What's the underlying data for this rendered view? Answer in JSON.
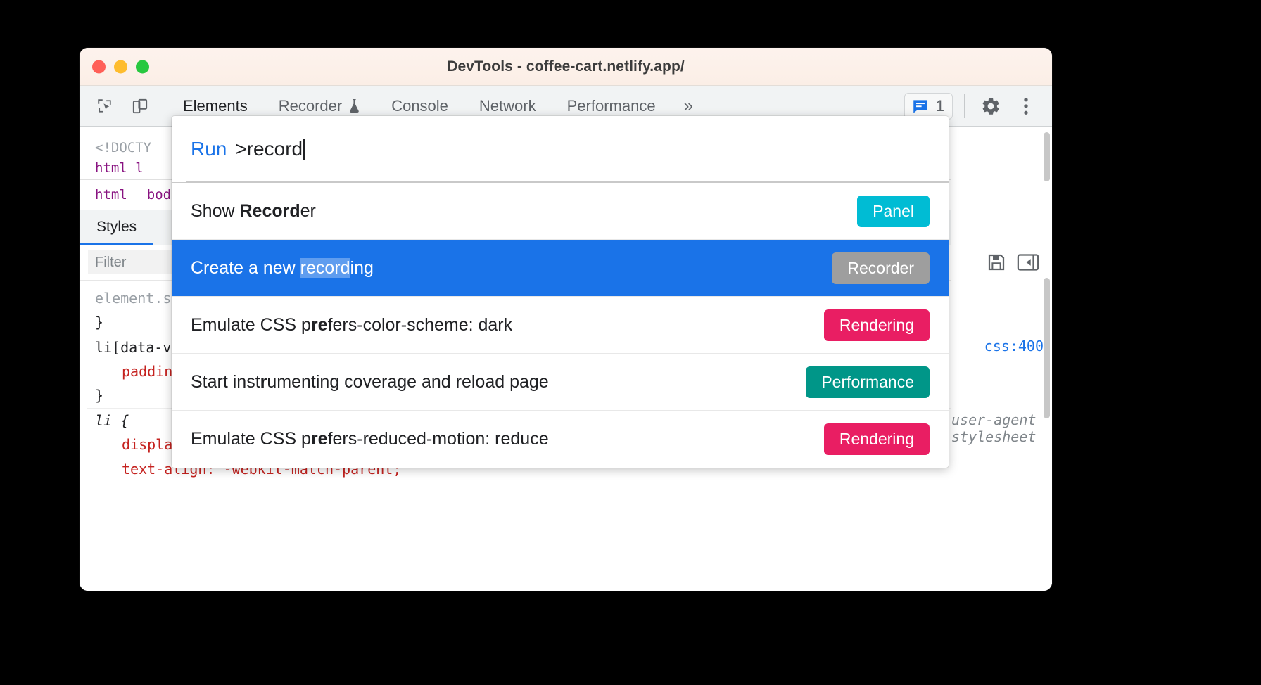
{
  "window": {
    "title": "DevTools - coffee-cart.netlify.app/",
    "traffic_lights": [
      "close-red",
      "minimize-yellow",
      "maximize-green"
    ]
  },
  "toolbar": {
    "icons": [
      "inspect-element-icon",
      "device-toolbar-icon"
    ],
    "tabs": [
      {
        "label": "Elements",
        "active": true,
        "icon": ""
      },
      {
        "label": "Recorder",
        "active": false,
        "icon": "flask-icon"
      },
      {
        "label": "Console",
        "active": false,
        "icon": ""
      },
      {
        "label": "Network",
        "active": false,
        "icon": ""
      },
      {
        "label": "Performance",
        "active": false,
        "icon": ""
      }
    ],
    "more_tabs": "»",
    "message_count": "1",
    "message_icon": "message-bubble-icon",
    "settings_icon": "gear-icon",
    "menu_icon": "three-dot-menu-icon"
  },
  "palette": {
    "prefix": "Run",
    "query": ">record",
    "commands": [
      {
        "text_before": "Show ",
        "text_match": "Record",
        "text_after": "er",
        "badge": "Panel",
        "badge_color": "#00bcd4",
        "selected": false
      },
      {
        "text_before": "Create a new ",
        "text_match": "record",
        "text_after": "ing",
        "badge": "Recorder",
        "badge_color": "#9e9e9e",
        "selected": true
      },
      {
        "text_before": "Emulate CSS p",
        "text_match": "re",
        "text_after": "fers-color-scheme: dark",
        "badge": "Rendering",
        "badge_color": "#e91e63",
        "selected": false
      },
      {
        "text_before": "Start inst",
        "text_match": "r",
        "text_after": "umenting coverage and reload page",
        "badge": "Performance",
        "badge_color": "#009688",
        "selected": false
      },
      {
        "text_before": "Emulate CSS p",
        "text_match": "re",
        "text_after": "fers-reduced-motion: reduce",
        "badge": "Rendering",
        "badge_color": "#e91e63",
        "selected": false
      }
    ]
  },
  "elements_panel": {
    "doctype_line": "<!DOCTY",
    "html_line": "html l",
    "breadcrumb": [
      "html",
      "bod"
    ],
    "styles_tab": "Styles",
    "filter_placeholder": "Filter",
    "css_rules": [
      {
        "selector": "element.s",
        "close": "}"
      },
      {
        "selector": "li[data-v",
        "prop": "paddin",
        "close": "}"
      },
      {
        "selector": "li {",
        "decls": [
          "display: list-item;",
          "text-align: -webkit-match-parent;"
        ]
      }
    ],
    "right_code": "css:400",
    "ua_stylesheet": "user-agent stylesheet",
    "right_icons": [
      "save-icon",
      "toggle-sidebar-icon"
    ]
  }
}
